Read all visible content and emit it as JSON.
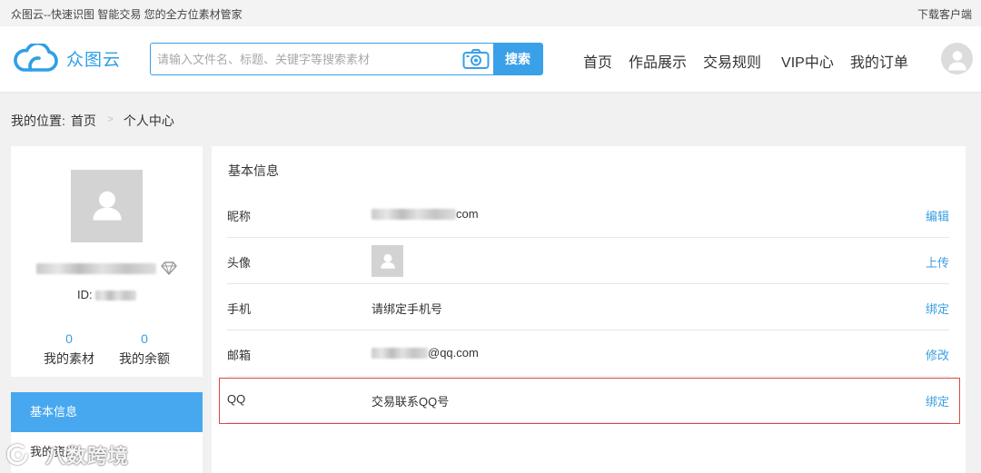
{
  "topbar": {
    "slogan": "众图云--快速识图 智能交易 您的全方位素材管家",
    "download": "下载客户端"
  },
  "header": {
    "logo_icon": "cloud-icon",
    "logo_text": "众图云",
    "search": {
      "placeholder": "请输入文件名、标题、关键字等搜索素材",
      "image_search_icon": "camera-icon",
      "button": "搜索"
    },
    "nav": [
      "首页",
      "作品展示",
      "交易规则",
      "VIP中心",
      "我的订单"
    ],
    "user_icon": "user-avatar-icon"
  },
  "breadcrumb": {
    "prefix": "我的位置:",
    "separator": ">",
    "items": [
      "首页",
      "个人中心"
    ]
  },
  "profile": {
    "avatar_icon": "user-placeholder-icon",
    "level_icon": "diamond-icon",
    "id_label": "ID:",
    "stats": [
      {
        "value": "0",
        "label": "我的素材"
      },
      {
        "value": "0",
        "label": "我的余额"
      }
    ]
  },
  "sidenav": {
    "items": [
      {
        "label": "基本信息",
        "active": true
      },
      {
        "label": "我的资产",
        "active": false
      }
    ]
  },
  "basic_info": {
    "title": "基本信息",
    "rows": [
      {
        "label": "昵称",
        "value": "com",
        "action": "编辑"
      },
      {
        "label": "头像",
        "action": "上传"
      },
      {
        "label": "手机",
        "value": "请绑定手机号",
        "action": "绑定"
      },
      {
        "label": "邮箱",
        "value": "@qq.com",
        "action": "修改"
      },
      {
        "label": "QQ",
        "value": "交易联系QQ号",
        "action": "绑定",
        "highlighted": true
      }
    ]
  },
  "watermark": {
    "text": "八数跨境"
  },
  "colors": {
    "brand": "#2e9fe6",
    "link": "#3a9ee2",
    "active": "#47a8ef",
    "hl": "#d84a45"
  }
}
